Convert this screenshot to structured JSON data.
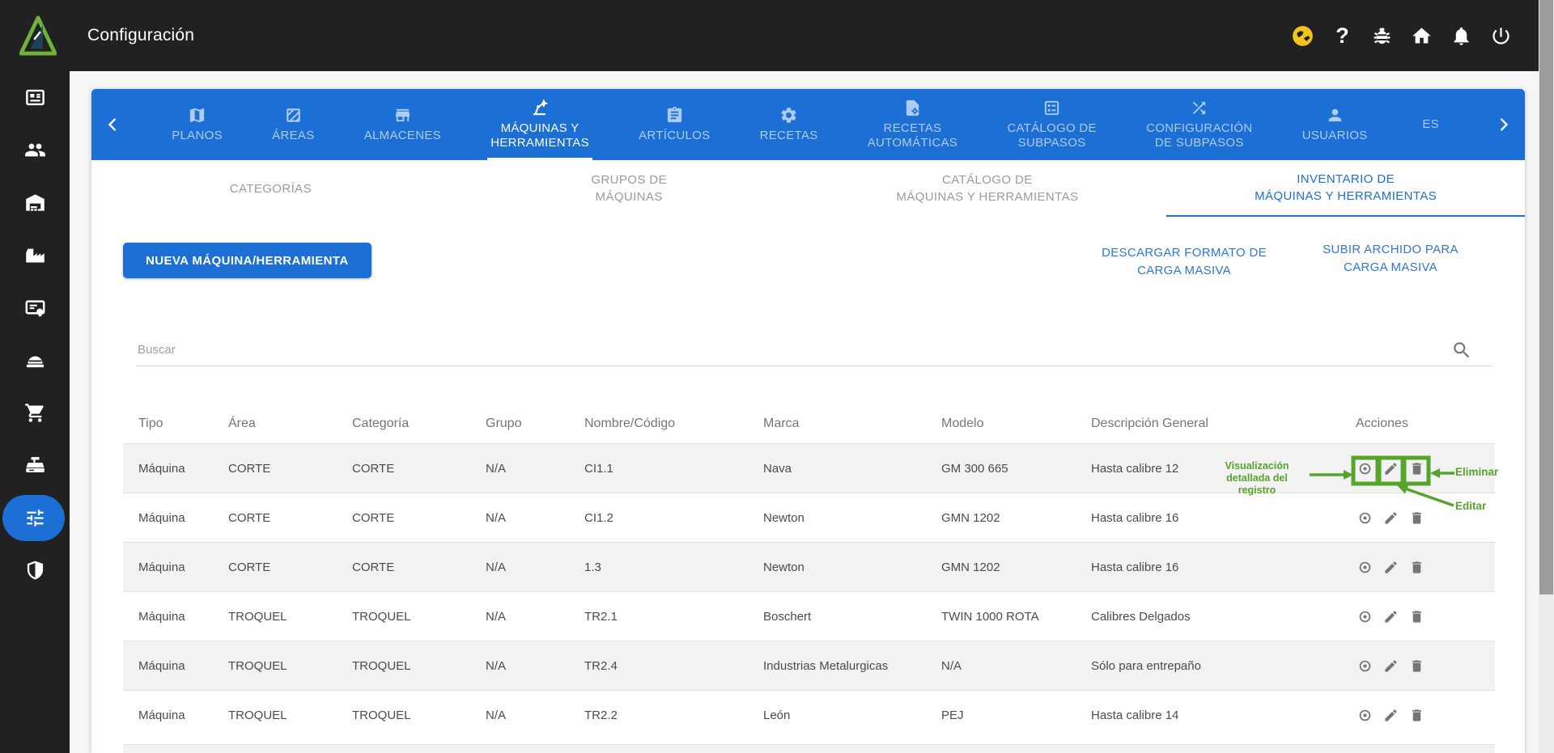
{
  "topbar": {
    "title": "Configuración",
    "icons": [
      "globe-language-icon",
      "help-icon",
      "bug-report-icon",
      "home-icon",
      "notifications-icon",
      "power-icon"
    ]
  },
  "sidebar": {
    "active_index": 8,
    "items": [
      {
        "icon": "news-card-icon"
      },
      {
        "icon": "users-group-icon"
      },
      {
        "icon": "warehouse-icon"
      },
      {
        "icon": "factory-icon"
      },
      {
        "icon": "certificate-icon"
      },
      {
        "icon": "machine-icon"
      },
      {
        "icon": "shopping-cart-icon"
      },
      {
        "icon": "cash-register-icon"
      },
      {
        "icon": "settings-sliders-icon"
      },
      {
        "icon": "security-shield-icon"
      }
    ]
  },
  "tabbar": {
    "active_index": 3,
    "prev_icon": "chevron-left-icon",
    "next_icon": "chevron-right-icon",
    "tabs": [
      {
        "label": "PLANOS",
        "icon": "map-icon"
      },
      {
        "label": "ÁREAS",
        "icon": "hatched-area-icon"
      },
      {
        "label": "ALMACENES",
        "icon": "store-icon"
      },
      {
        "label": "MÁQUINAS Y\nHERRAMIENTAS",
        "icon": "robot-arm-icon"
      },
      {
        "label": "ARTÍCULOS",
        "icon": "clipboard-icon"
      },
      {
        "label": "RECETAS",
        "icon": "gear-icon"
      },
      {
        "label": "RECETAS\nAUTOMÁTICAS",
        "icon": "file-gear-icon"
      },
      {
        "label": "CATÁLOGO DE\nSUBPASOS",
        "icon": "ballot-icon"
      },
      {
        "label": "CONFIGURACIÓN\nDE SUBPASOS",
        "icon": "shuffle-icon"
      },
      {
        "label": "USUARIOS",
        "icon": "person-icon"
      },
      {
        "label": "ES",
        "icon": null
      }
    ]
  },
  "subtabs": {
    "active_index": 3,
    "items": [
      {
        "label": "CATEGORÍAS"
      },
      {
        "label": "GRUPOS DE\nMÁQUINAS"
      },
      {
        "label": "CATÁLOGO DE\nMÁQUINAS Y HERRAMIENTAS"
      },
      {
        "label": "INVENTARIO DE\nMÁQUINAS Y HERRAMIENTAS"
      }
    ]
  },
  "toolbar": {
    "new_button": "NUEVA MÁQUINA/HERRAMIENTA",
    "download_link": "DESCARGAR FORMATO DE\nCARGA MASIVA",
    "upload_link": "SUBIR ARCHIDO PARA\nCARGA MASIVA"
  },
  "search": {
    "placeholder": "Buscar",
    "icon": "search-icon"
  },
  "table": {
    "columns": [
      "Tipo",
      "Área",
      "Categoría",
      "Grupo",
      "Nombre/Código",
      "Marca",
      "Modelo",
      "Descripción General",
      "Acciones"
    ],
    "row_action_icons": [
      "view-eye-icon",
      "edit-pencil-icon",
      "delete-trash-icon"
    ],
    "rows": [
      [
        "Máquina",
        "CORTE",
        "CORTE",
        "N/A",
        "CI1.1",
        "Nava",
        "GM 300 665",
        "Hasta calibre 12"
      ],
      [
        "Máquina",
        "CORTE",
        "CORTE",
        "N/A",
        "CI1.2",
        "Newton",
        "GMN 1202",
        "Hasta calibre 16"
      ],
      [
        "Máquina",
        "CORTE",
        "CORTE",
        "N/A",
        "1.3",
        "Newton",
        "GMN 1202",
        "Hasta calibre 16"
      ],
      [
        "Máquina",
        "TROQUEL",
        "TROQUEL",
        "N/A",
        "TR2.1",
        "Boschert",
        "TWIN 1000 ROTA",
        "Calibres Delgados"
      ],
      [
        "Máquina",
        "TROQUEL",
        "TROQUEL",
        "N/A",
        "TR2.4",
        "Industrias Metalurgicas",
        "N/A",
        "Sólo para entrepaño"
      ],
      [
        "Máquina",
        "TROQUEL",
        "TROQUEL",
        "N/A",
        "TR2.2",
        "León",
        "PEJ",
        "Hasta calibre 14"
      ]
    ]
  },
  "annotations": {
    "view_label": "Visualización\ndetallada del\nregistro",
    "delete_label": "Eliminar",
    "edit_label": "Editar"
  },
  "colors": {
    "primary_blue": "#1C6FD4",
    "topbar_bg": "#212121",
    "annotation_green": "#56A42C",
    "globe_yellow": "#F2C51D",
    "row_stripe": "#F2F2F2"
  }
}
